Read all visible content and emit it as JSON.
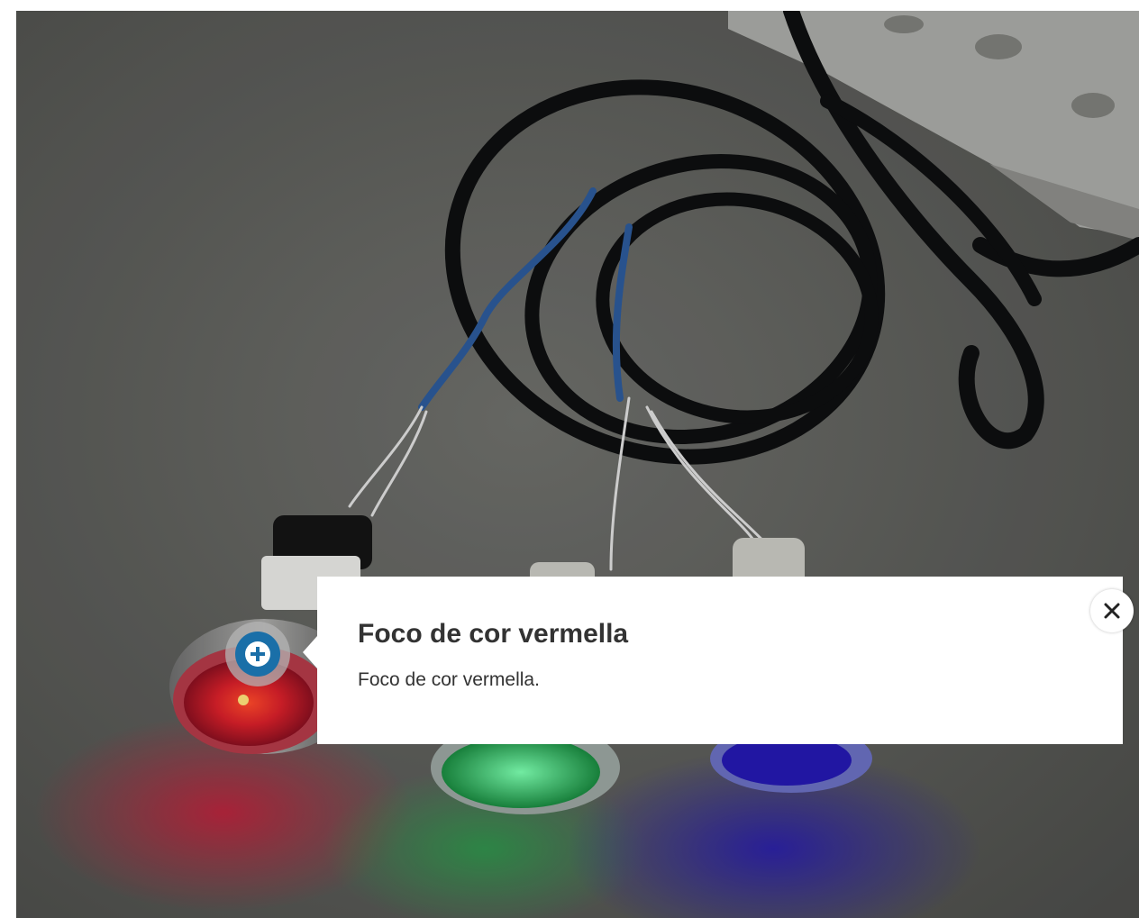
{
  "hotspot": {
    "icon": "plus-circle-icon",
    "accent_color": "#1a6fa8"
  },
  "popup": {
    "title": "Foco de cor vermella",
    "text": "Foco de cor vermella."
  },
  "close": {
    "icon": "close-icon"
  }
}
